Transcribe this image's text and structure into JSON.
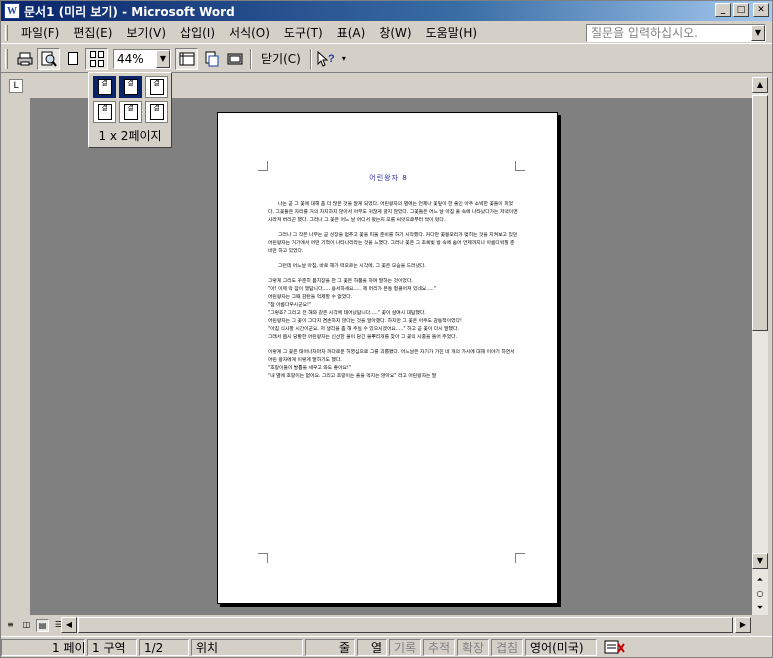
{
  "window": {
    "title": "문서1 (미리 보기) - Microsoft Word",
    "app_icon": "word-icon",
    "controls": [
      "minimize-icon",
      "maximize-icon",
      "close-icon"
    ]
  },
  "menu": {
    "items": [
      "파일(F)",
      "편집(E)",
      "보기(V)",
      "삽입(I)",
      "서식(O)",
      "도구(T)",
      "표(A)",
      "창(W)",
      "도움말(H)"
    ],
    "help_placeholder": "질문을 입력하십시오."
  },
  "toolbar": {
    "buttons": [
      "print-icon",
      "magnifier-icon",
      "one-page-icon",
      "multiple-pages-icon",
      "view-ruler-icon",
      "shrink-to-fit-icon",
      "full-screen-icon",
      "context-help-icon"
    ],
    "zoom_value": "44%",
    "close_label": "닫기(C)"
  },
  "popup": {
    "label": "1 x 2페이지",
    "selected_cols": 2,
    "selected_rows": 1,
    "cell_glyph": "결"
  },
  "document": {
    "title": "어린왕자 8",
    "paragraphs": [
      "나는 곧 그 꽃에 대해 좀 더 많은 것을 알게 되었다. 어린왕자의 별에는 언제나 꽃잎이 한 줄인 아주 소박한 꽃들이 피었다. 그꽃들은 자리를 거의 차지하지 않아서 아무도 귀찮게 굴지 않았다. 그꽃들은 어느 날 아침 풀 속에 나타났다가는 저녁이면 사라져 버리곤 했다. 그러나 그 꽃은 어느 날 어디서 왔는지 모를 씨앗으로부터 싹이 텄다.",
      "그러나 그 작은 나무는 곧 성장을 멈추고 꽃을 피울 준비를 하기 시작했다. 커다란 꽃봉오리가 맺히는 것을 지켜보고 있던 어린왕자는 거기에서 어떤 기적이 나타나리라는 것을 느꼈다. 그러나 꽃은 그 초록빛 방 속에 숨어 언제까지나 아름다워질 준비만 하고 있었다.",
      "그런데 어느날 아침, 바로 해가 떠오르는 시각에, 그 꽃은 모습을 드러냈다.",
      "그렇게 그리도 꾸준히 몸치장을 한 그 꽃은 하품을 하며 말하는 것이었다.",
      "\"아! 이제 막 잠이 깼답니다..... 용서하세요..... 제 머리가 온통 헝클어져 있네요.....\"",
      "어린왕자는 그때 감탄을 억제할 수 없었다.",
      "\"참 아름다우시군요!\"",
      "\"그렇죠? 그리고 전 해와 같은 시각에 태어났답니다.....\" 꽃이 살며시 대답했다.",
      "어린왕자는 그 꽃이 그다지 겸손하지 않다는 것을 알아챘다. 하지만 그 꽃은 아주도 감동적이었다!",
      "\"아침 식사할 시간이군요. 저 생각을 좀 해 주실 수 있으시겠어요.....\" 하고 곧 꽃이 다시 말했다.",
      "그래서 몹시 당황한 어린왕자는 신선한 물이 담긴 물뿌리개를 찾아 그 꽃의 시중을 들어 주었다.",
      "이렇게 그 꽃은 태어나자마자 까다로운 허영심으로 그를 괴롭혔다. 어느날은 자기가 가진 네 개의 가시에 대해 이야기 하면서 어린 왕자에게 이렇게 말하기도 했다.",
      "\"호랑이들이 발톱을 세우고 와도 좋아요!\"",
      "\"내 별에 호랑이는 없어요. 그리고 호랑이는 풀을 먹지는 않아요\" 라고 어린왕자는 말"
    ]
  },
  "statusbar": {
    "page": "1 페이지",
    "section": "1 구역",
    "page_of": "1/2",
    "position": "위치",
    "line": "줄",
    "col": "열",
    "rec": "기록",
    "trk": "추적",
    "ext": "확장",
    "ovr": "겹침",
    "language": "영어(미국)"
  },
  "colors": {
    "titlebar_start": "#0a246a",
    "titlebar_end": "#a6caf0",
    "doc_title": "#2a2ab0",
    "workspace": "#808080"
  }
}
